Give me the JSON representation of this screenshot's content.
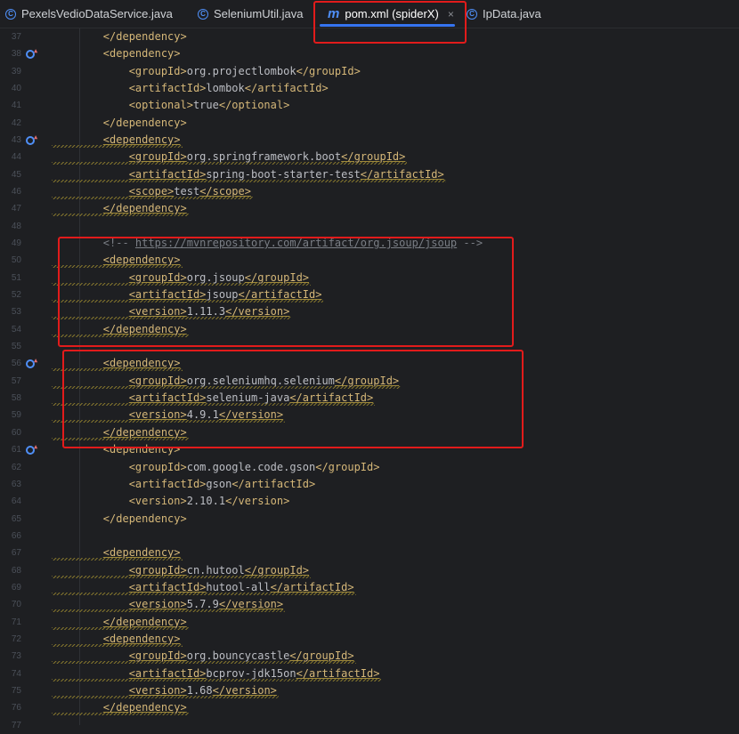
{
  "tabs": [
    {
      "label": "PexelsVedioDataService.java",
      "icon": "class-icon",
      "active": false
    },
    {
      "label": "SeleniumUtil.java",
      "icon": "class-icon",
      "active": false
    },
    {
      "label": "pom.xml (spiderX)",
      "icon": "maven-icon",
      "active": true
    },
    {
      "label": "IpData.java",
      "icon": "class-icon",
      "active": false
    }
  ],
  "active_tab_close": "×",
  "maven_glyph": "m",
  "class_glyph": "C",
  "lines": [
    {
      "n": "37",
      "code": "        </dependency>"
    },
    {
      "n": "38",
      "code": "        <dependency>"
    },
    {
      "n": "39",
      "code": "            <groupId>org.projectlombok</groupId>"
    },
    {
      "n": "40",
      "code": "            <artifactId>lombok</artifactId>"
    },
    {
      "n": "41",
      "code": "            <optional>true</optional>"
    },
    {
      "n": "42",
      "code": "        </dependency>"
    },
    {
      "n": "43",
      "code": "        <dependency>"
    },
    {
      "n": "44",
      "code": "            <groupId>org.springframework.boot</groupId>"
    },
    {
      "n": "45",
      "code": "            <artifactId>spring-boot-starter-test</artifactId>"
    },
    {
      "n": "46",
      "code": "            <scope>test</scope>"
    },
    {
      "n": "47",
      "code": "        </dependency>"
    },
    {
      "n": "48",
      "code": ""
    },
    {
      "n": "49",
      "code": "        <!-- https://mvnrepository.com/artifact/org.jsoup/jsoup -->"
    },
    {
      "n": "50",
      "code": "        <dependency>"
    },
    {
      "n": "51",
      "code": "            <groupId>org.jsoup</groupId>"
    },
    {
      "n": "52",
      "code": "            <artifactId>jsoup</artifactId>"
    },
    {
      "n": "53",
      "code": "            <version>1.11.3</version>"
    },
    {
      "n": "54",
      "code": "        </dependency>"
    },
    {
      "n": "55",
      "code": ""
    },
    {
      "n": "56",
      "code": "        <dependency>"
    },
    {
      "n": "57",
      "code": "            <groupId>org.seleniumhq.selenium</groupId>"
    },
    {
      "n": "58",
      "code": "            <artifactId>selenium-java</artifactId>"
    },
    {
      "n": "59",
      "code": "            <version>4.9.1</version>"
    },
    {
      "n": "60",
      "code": "        </dependency>"
    },
    {
      "n": "61",
      "code": "        <dependency>"
    },
    {
      "n": "62",
      "code": "            <groupId>com.google.code.gson</groupId>"
    },
    {
      "n": "63",
      "code": "            <artifactId>gson</artifactId>"
    },
    {
      "n": "64",
      "code": "            <version>2.10.1</version>"
    },
    {
      "n": "65",
      "code": "        </dependency>"
    },
    {
      "n": "66",
      "code": ""
    },
    {
      "n": "67",
      "code": "        <dependency>"
    },
    {
      "n": "68",
      "code": "            <groupId>cn.hutool</groupId>"
    },
    {
      "n": "69",
      "code": "            <artifactId>hutool-all</artifactId>"
    },
    {
      "n": "70",
      "code": "            <version>5.7.9</version>"
    },
    {
      "n": "71",
      "code": "        </dependency>"
    },
    {
      "n": "72",
      "code": "        <dependency>"
    },
    {
      "n": "73",
      "code": "            <groupId>org.bouncycastle</groupId>"
    },
    {
      "n": "74",
      "code": "            <artifactId>bcprov-jdk15on</artifactId>"
    },
    {
      "n": "75",
      "code": "            <version>1.68</version>"
    },
    {
      "n": "76",
      "code": "        </dependency>"
    },
    {
      "n": "77",
      "code": ""
    }
  ],
  "gutter_markers": [
    "38",
    "43",
    "56",
    "61"
  ],
  "warning_lines": [
    "43",
    "44",
    "45",
    "46",
    "47",
    "50",
    "51",
    "52",
    "53",
    "54",
    "56",
    "57",
    "58",
    "59",
    "60",
    "67",
    "68",
    "69",
    "70",
    "71",
    "72",
    "73",
    "74",
    "75",
    "76"
  ],
  "colors": {
    "background": "#1e1f22",
    "tag": "#d5b778",
    "text": "#bcbec4",
    "comment": "#7a7e85",
    "line_number": "#4b5059",
    "accent": "#3574f0",
    "highlight_box": "#e21b1b"
  }
}
